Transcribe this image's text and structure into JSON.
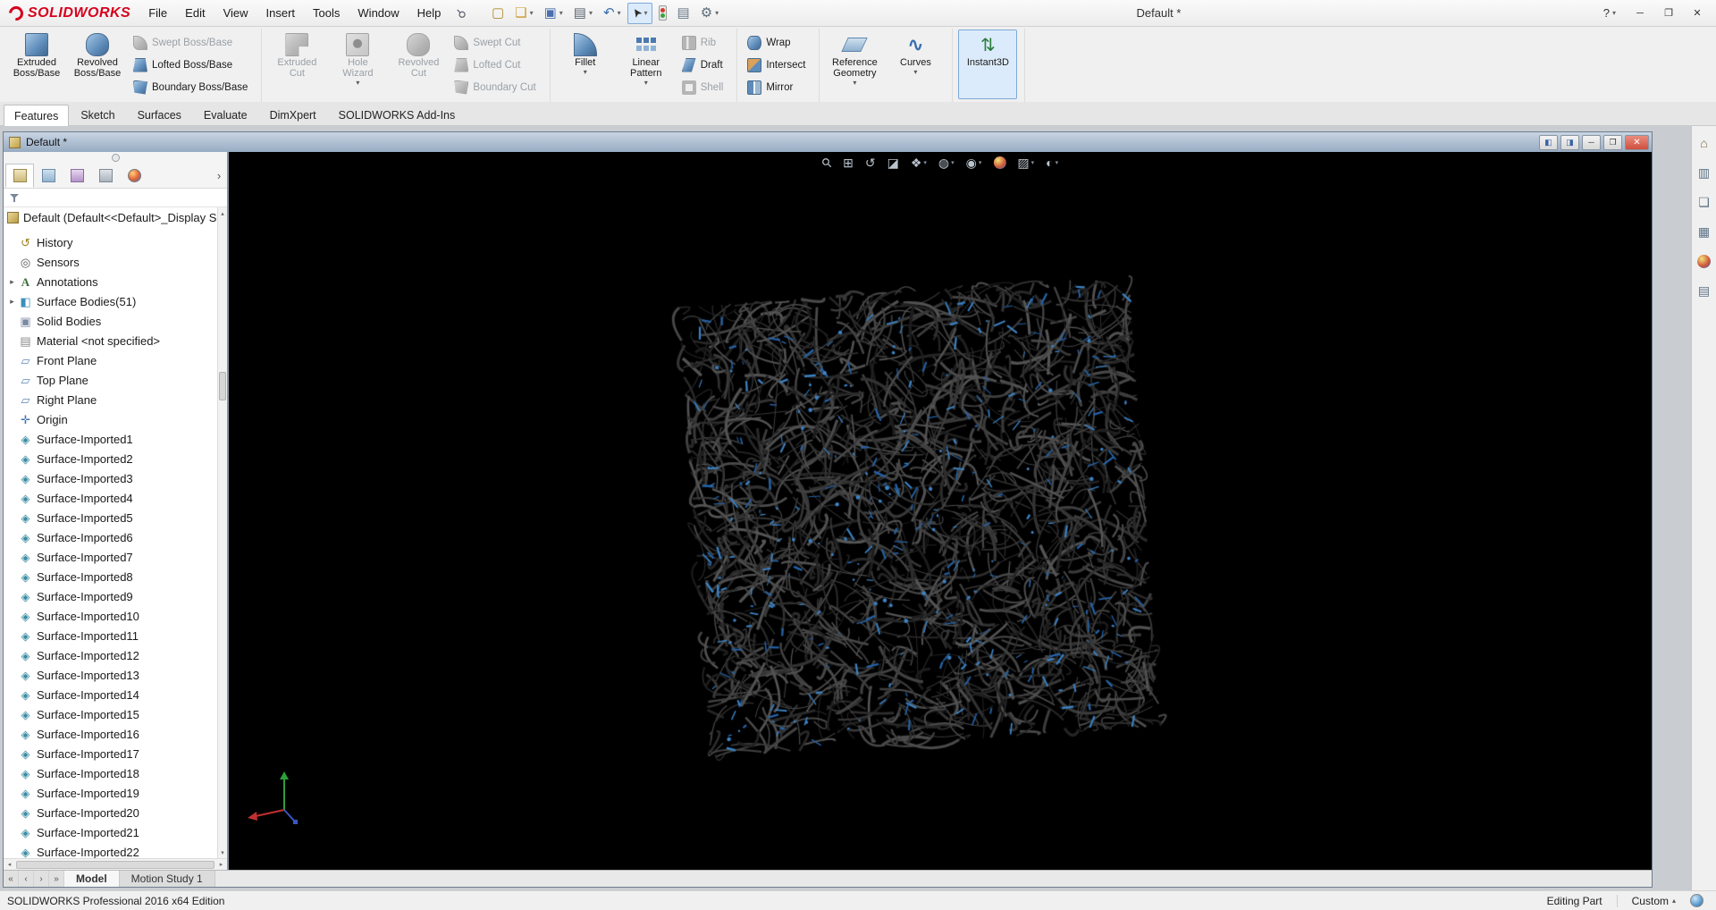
{
  "glyphs": {
    "dropdown": "▾",
    "expander": "▸",
    "up": "▴",
    "down": "▾",
    "left": "◂",
    "right": "▸",
    "chevron": "›"
  },
  "colors": {
    "logo_red": "#d6001c",
    "accent_blue": "#2f7fd1",
    "viewport_background": "#000000",
    "doc_close_red": "#cf4f3e"
  },
  "app": {
    "logo_text": "SOLIDWORKS",
    "title": "Default *",
    "help_label": "?",
    "window_buttons": [
      {
        "name": "app-minimize-button",
        "glyph": "─"
      },
      {
        "name": "app-restore-button",
        "glyph": "❐"
      },
      {
        "name": "app-close-button",
        "glyph": "✕"
      }
    ]
  },
  "menubar": {
    "items": [
      "File",
      "Edit",
      "View",
      "Insert",
      "Tools",
      "Window",
      "Help"
    ],
    "pin_glyph": "⚲"
  },
  "quick_toolbar": {
    "buttons": [
      {
        "name": "new-document-button",
        "icon": "new-document-icon",
        "glyph": "▢"
      },
      {
        "name": "open-button",
        "icon": "open-icon",
        "glyph": "❏",
        "dropdown": true
      },
      {
        "name": "save-button",
        "icon": "save-icon",
        "glyph": "▣",
        "dropdown": true
      },
      {
        "name": "print-button",
        "icon": "print-icon",
        "glyph": "▤",
        "dropdown": true
      },
      {
        "name": "undo-button",
        "icon": "undo-icon",
        "glyph": "↶",
        "dropdown": true
      },
      {
        "name": "select-button",
        "icon": "select-icon",
        "glyph": "➤",
        "dropdown": true,
        "active": true
      },
      {
        "name": "rebuild-button",
        "icon": "rebuild-icon",
        "glyph": ""
      },
      {
        "name": "file-properties-button",
        "icon": "file-properties-icon",
        "glyph": "▤"
      },
      {
        "name": "options-button",
        "icon": "options-icon",
        "glyph": "⚙",
        "dropdown": true
      }
    ]
  },
  "ribbon": {
    "tabs": [
      {
        "name": "tab-features",
        "label": "Features",
        "active": true
      },
      {
        "name": "tab-sketch",
        "label": "Sketch"
      },
      {
        "name": "tab-surfaces",
        "label": "Surfaces"
      },
      {
        "name": "tab-evaluate",
        "label": "Evaluate"
      },
      {
        "name": "tab-dimxpert",
        "label": "DimXpert"
      },
      {
        "name": "tab-solidworks-add-ins",
        "label": "SOLIDWORKS Add-Ins"
      }
    ],
    "groups": [
      {
        "name": "boss-base-group",
        "large": [
          {
            "name": "extruded-boss-base-button",
            "label": "Extruded\nBoss/Base",
            "icon": "extruded-boss-icon",
            "enabled": true
          },
          {
            "name": "revolved-boss-base-button",
            "label": "Revolved\nBoss/Base",
            "icon": "revolved-boss-icon",
            "enabled": true
          }
        ],
        "small": [
          {
            "name": "swept-boss-base-button",
            "label": "Swept Boss/Base",
            "icon": "swept-boss-icon",
            "enabled": false
          },
          {
            "name": "lofted-boss-base-button",
            "label": "Lofted Boss/Base",
            "icon": "lofted-boss-icon",
            "enabled": true
          },
          {
            "name": "boundary-boss-base-button",
            "label": "Boundary Boss/Base",
            "icon": "boundary-boss-icon",
            "enabled": true
          }
        ]
      },
      {
        "name": "cut-group",
        "large": [
          {
            "name": "extruded-cut-button",
            "label": "Extruded\nCut",
            "icon": "extruded-cut-icon",
            "enabled": false
          },
          {
            "name": "hole-wizard-button",
            "label": "Hole\nWizard",
            "icon": "hole-wizard-icon",
            "enabled": false,
            "flyout": true
          },
          {
            "name": "revolved-cut-button",
            "label": "Revolved\nCut",
            "icon": "revolved-cut-icon",
            "enabled": false
          }
        ],
        "small": [
          {
            "name": "swept-cut-button",
            "label": "Swept Cut",
            "icon": "swept-cut-icon",
            "enabled": false
          },
          {
            "name": "lofted-cut-button",
            "label": "Lofted Cut",
            "icon": "lofted-cut-icon",
            "enabled": false
          },
          {
            "name": "boundary-cut-button",
            "label": "Boundary Cut",
            "icon": "boundary-cut-icon",
            "enabled": false
          }
        ]
      },
      {
        "name": "features-group",
        "large": [
          {
            "name": "fillet-button",
            "label": "Fillet",
            "icon": "fillet-icon",
            "enabled": true,
            "flyout": true
          },
          {
            "name": "linear-pattern-button",
            "label": "Linear\nPattern",
            "icon": "linear-pattern-icon",
            "enabled": true,
            "flyout": true
          }
        ],
        "small": [
          {
            "name": "rib-button",
            "label": "Rib",
            "icon": "rib-icon",
            "enabled": false
          },
          {
            "name": "draft-button",
            "label": "Draft",
            "icon": "draft-icon",
            "enabled": true
          },
          {
            "name": "shell-button",
            "label": "Shell",
            "icon": "shell-icon",
            "enabled": false
          }
        ]
      },
      {
        "name": "wrap-group",
        "large": [],
        "small": [
          {
            "name": "wrap-button",
            "label": "Wrap",
            "icon": "wrap-icon",
            "enabled": true
          },
          {
            "name": "intersect-button",
            "label": "Intersect",
            "icon": "intersect-icon",
            "enabled": true
          },
          {
            "name": "mirror-button",
            "label": "Mirror",
            "icon": "mirror-icon",
            "enabled": true
          }
        ]
      },
      {
        "name": "reference-group",
        "large": [
          {
            "name": "reference-geometry-button",
            "label": "Reference\nGeometry",
            "icon": "reference-geometry-icon",
            "enabled": true,
            "flyout": true
          },
          {
            "name": "curves-button",
            "label": "Curves",
            "icon": "curves-icon",
            "enabled": true,
            "flyout": true
          }
        ],
        "small": []
      },
      {
        "name": "instant3d-group",
        "large": [
          {
            "name": "instant3d-button",
            "label": "Instant3D",
            "icon": "instant3d-icon",
            "enabled": true,
            "active": true
          }
        ],
        "small": []
      }
    ]
  },
  "document_window": {
    "title": "Default *",
    "buttons": [
      {
        "name": "doc-pane-left-button",
        "glyph": "◧"
      },
      {
        "name": "doc-pane-right-button",
        "glyph": "◨"
      },
      {
        "name": "doc-minimize-button",
        "glyph": "─"
      },
      {
        "name": "doc-restore-button",
        "glyph": "❐"
      },
      {
        "name": "doc-close-button",
        "glyph": "✕"
      }
    ]
  },
  "feature_tree": {
    "root": "Default (Default<<Default>_Display S",
    "panel_tabs": [
      {
        "name": "featuremanager-tab",
        "icon": "featuremanager-tab-icon",
        "active": true
      },
      {
        "name": "propertymanager-tab",
        "icon": "propertymanager-tab-icon"
      },
      {
        "name": "configurationmanager-tab",
        "icon": "configurationmanager-tab-icon"
      },
      {
        "name": "dimxpertmanager-tab",
        "icon": "dimxpertmanager-tab-icon"
      },
      {
        "name": "displaymanager-tab",
        "icon": "displaymanager-tab-icon"
      }
    ],
    "items": [
      {
        "label": "History",
        "icon": "history-icon"
      },
      {
        "label": "Sensors",
        "icon": "sensors-icon"
      },
      {
        "label": "Annotations",
        "icon": "annotations-icon",
        "expandable": true
      },
      {
        "label": "Surface Bodies(51)",
        "icon": "surface-bodies-icon",
        "expandable": true
      },
      {
        "label": "Solid Bodies",
        "icon": "solid-bodies-icon"
      },
      {
        "label": "Material <not specified>",
        "icon": "material-icon"
      },
      {
        "label": "Front Plane",
        "icon": "plane-icon"
      },
      {
        "label": "Top Plane",
        "icon": "plane-icon"
      },
      {
        "label": "Right Plane",
        "icon": "plane-icon"
      },
      {
        "label": "Origin",
        "icon": "origin-icon"
      },
      {
        "label": "Surface-Imported1",
        "icon": "surface-imported-icon"
      },
      {
        "label": "Surface-Imported2",
        "icon": "surface-imported-icon"
      },
      {
        "label": "Surface-Imported3",
        "icon": "surface-imported-icon"
      },
      {
        "label": "Surface-Imported4",
        "icon": "surface-imported-icon"
      },
      {
        "label": "Surface-Imported5",
        "icon": "surface-imported-icon"
      },
      {
        "label": "Surface-Imported6",
        "icon": "surface-imported-icon"
      },
      {
        "label": "Surface-Imported7",
        "icon": "surface-imported-icon"
      },
      {
        "label": "Surface-Imported8",
        "icon": "surface-imported-icon"
      },
      {
        "label": "Surface-Imported9",
        "icon": "surface-imported-icon"
      },
      {
        "label": "Surface-Imported10",
        "icon": "surface-imported-icon"
      },
      {
        "label": "Surface-Imported11",
        "icon": "surface-imported-icon"
      },
      {
        "label": "Surface-Imported12",
        "icon": "surface-imported-icon"
      },
      {
        "label": "Surface-Imported13",
        "icon": "surface-imported-icon"
      },
      {
        "label": "Surface-Imported14",
        "icon": "surface-imported-icon"
      },
      {
        "label": "Surface-Imported15",
        "icon": "surface-imported-icon"
      },
      {
        "label": "Surface-Imported16",
        "icon": "surface-imported-icon"
      },
      {
        "label": "Surface-Imported17",
        "icon": "surface-imported-icon"
      },
      {
        "label": "Surface-Imported18",
        "icon": "surface-imported-icon"
      },
      {
        "label": "Surface-Imported19",
        "icon": "surface-imported-icon"
      },
      {
        "label": "Surface-Imported20",
        "icon": "surface-imported-icon"
      },
      {
        "label": "Surface-Imported21",
        "icon": "surface-imported-icon"
      },
      {
        "label": "Surface-Imported22",
        "icon": "surface-imported-icon"
      }
    ]
  },
  "viewport": {
    "hud": [
      {
        "name": "zoom-to-fit-button",
        "icon": "zoom-to-fit-icon",
        "glyph": "⚲"
      },
      {
        "name": "zoom-to-area-button",
        "icon": "zoom-to-area-icon",
        "glyph": "⊞"
      },
      {
        "name": "previous-view-button",
        "icon": "previous-view-icon",
        "glyph": "↺"
      },
      {
        "name": "section-view-button",
        "icon": "section-view-icon",
        "glyph": "◪"
      },
      {
        "name": "view-orientation-button",
        "icon": "view-orientation-icon",
        "glyph": "❖",
        "dropdown": true
      },
      {
        "name": "display-style-button",
        "icon": "display-style-icon",
        "glyph": "◍",
        "dropdown": true
      },
      {
        "name": "hide-show-items-button",
        "icon": "hide-show-items-icon",
        "glyph": "◉",
        "dropdown": true
      },
      {
        "name": "edit-appearance-button",
        "icon": "edit-appearance-icon",
        "glyph": ""
      },
      {
        "name": "apply-scene-button",
        "icon": "apply-scene-icon",
        "glyph": "▨",
        "dropdown": true
      },
      {
        "name": "view-settings-button",
        "icon": "view-settings-icon",
        "glyph": "◐",
        "dropdown": true
      }
    ]
  },
  "task_pane": {
    "icons": [
      {
        "name": "solidworks-resources-button",
        "icon": "home-icon",
        "glyph": "⌂"
      },
      {
        "name": "design-library-button",
        "icon": "design-library-icon",
        "glyph": "▥"
      },
      {
        "name": "file-explorer-button",
        "icon": "file-explorer-icon",
        "glyph": "❏"
      },
      {
        "name": "view-palette-button",
        "icon": "view-palette-icon",
        "glyph": "▦"
      },
      {
        "name": "appearances-scenes-button",
        "icon": "appearances-scenes-icon",
        "glyph": ""
      },
      {
        "name": "custom-properties-button",
        "icon": "custom-properties-icon",
        "glyph": "▤"
      }
    ]
  },
  "bottom_tabs": {
    "scroll_buttons": [
      {
        "name": "tab-scroll-first-button",
        "glyph": "«"
      },
      {
        "name": "tab-scroll-prev-button",
        "glyph": "‹"
      },
      {
        "name": "tab-scroll-next-button",
        "glyph": "›"
      },
      {
        "name": "tab-scroll-last-button",
        "glyph": "»"
      }
    ],
    "tabs": [
      {
        "name": "model-tab",
        "label": "Model",
        "active": true
      },
      {
        "name": "motion-study-tab",
        "label": "Motion Study 1"
      }
    ]
  },
  "statusbar": {
    "left": "SOLIDWORKS Professional 2016 x64 Edition",
    "editing": "Editing Part",
    "units": "Custom"
  }
}
